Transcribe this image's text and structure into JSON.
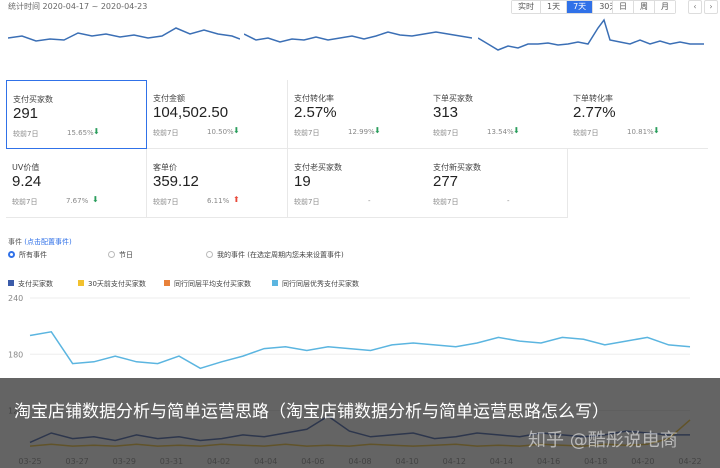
{
  "header": {
    "date_range": "统计时间 2020-04-17 ~ 2020-04-23",
    "range_tabs": [
      {
        "label": "实时",
        "active": false
      },
      {
        "label": "1天",
        "active": false
      },
      {
        "label": "7天",
        "active": true
      },
      {
        "label": "30天",
        "active": false
      }
    ],
    "period_tabs": [
      {
        "label": "日",
        "active": false
      },
      {
        "label": "周",
        "active": false
      },
      {
        "label": "月",
        "active": false
      }
    ],
    "prev_icon": "chevron-left-icon",
    "next_icon": "chevron-right-icon"
  },
  "kpis": [
    {
      "label": "支付买家数",
      "value": "291",
      "compare_label": "较前7日",
      "change": "15.65%",
      "trend": "down",
      "selected": true
    },
    {
      "label": "支付金额",
      "value": "104,502.50",
      "compare_label": "较前7日",
      "change": "10.50%",
      "trend": "down",
      "selected": false
    },
    {
      "label": "支付转化率",
      "value": "2.57%",
      "compare_label": "较前7日",
      "change": "12.99%",
      "trend": "down",
      "selected": false
    },
    {
      "label": "下单买家数",
      "value": "313",
      "compare_label": "较前7日",
      "change": "13.54%",
      "trend": "down",
      "selected": false
    },
    {
      "label": "下单转化率",
      "value": "2.77%",
      "compare_label": "较前7日",
      "change": "10.81%",
      "trend": "down",
      "selected": false
    },
    {
      "label": "UV价值",
      "value": "9.24",
      "compare_label": "较前7日",
      "change": "7.67%",
      "trend": "down",
      "selected": false
    },
    {
      "label": "客单价",
      "value": "359.12",
      "compare_label": "较前7日",
      "change": "6.11%",
      "trend": "up",
      "selected": false
    },
    {
      "label": "支付老买家数",
      "value": "19",
      "compare_label": "较前7日",
      "change": "-",
      "trend": "none",
      "selected": false
    },
    {
      "label": "支付新买家数",
      "value": "277",
      "compare_label": "较前7日",
      "change": "-",
      "trend": "none",
      "selected": false
    }
  ],
  "events": {
    "title": "事件",
    "config_link": "(点击配置事件)",
    "options": [
      {
        "label": "所有事件",
        "checked": true
      },
      {
        "label": "节日",
        "checked": false
      },
      {
        "label": "我的事件 (在选定周期内您未来设置事件)",
        "checked": false
      }
    ]
  },
  "legend": [
    {
      "label": "支付买家数",
      "color": "#3b5ba9"
    },
    {
      "label": "30天前支付买家数",
      "color": "#f2c12e"
    },
    {
      "label": "同行同层平均支付买家数",
      "color": "#e8813a"
    },
    {
      "label": "同行同层优秀支付买家数",
      "color": "#5bb5e0"
    }
  ],
  "chart_data": {
    "type": "line",
    "x": [
      "03-25",
      "03-27",
      "03-29",
      "03-31",
      "04-02",
      "04-04",
      "04-06",
      "04-08",
      "04-10",
      "04-12",
      "04-14",
      "04-16",
      "04-18",
      "04-20",
      "04-22"
    ],
    "yticks": [
      "240",
      "180",
      "120"
    ],
    "ylim": [
      80,
      240
    ],
    "series": [
      {
        "name": "同行同层优秀支付买家数",
        "color": "#5bb5e0",
        "values": [
          200,
          204,
          170,
          172,
          178,
          172,
          170,
          178,
          165,
          172,
          178,
          186,
          188,
          184,
          188,
          186,
          184,
          190,
          192,
          190,
          188,
          192,
          198,
          194,
          192,
          198,
          196,
          190,
          194,
          198,
          190,
          188
        ]
      },
      {
        "name": "支付买家数",
        "color": "#3b5ba9",
        "values": [
          86,
          96,
          90,
          92,
          88,
          94,
          90,
          92,
          88,
          90,
          94,
          92,
          96,
          100,
          114,
          98,
          92,
          94,
          96,
          90,
          92,
          96,
          94,
          92,
          96,
          94,
          92,
          94,
          98,
          96,
          94,
          94
        ]
      },
      {
        "name": "30天前支付买家数",
        "color": "#f2c12e",
        "values": [
          82,
          84,
          82,
          83,
          82,
          84,
          82,
          83,
          82,
          84,
          83,
          82,
          84,
          82,
          83,
          82,
          84,
          83,
          82,
          83,
          84,
          82,
          83,
          82,
          84,
          83,
          82,
          84,
          83,
          84,
          90,
          110
        ]
      }
    ]
  },
  "caption": "淘宝店铺数据分析与简单运营思路（淘宝店铺数据分析与简单运营思路怎么写）",
  "watermark": "知乎 @酷彤说电商"
}
